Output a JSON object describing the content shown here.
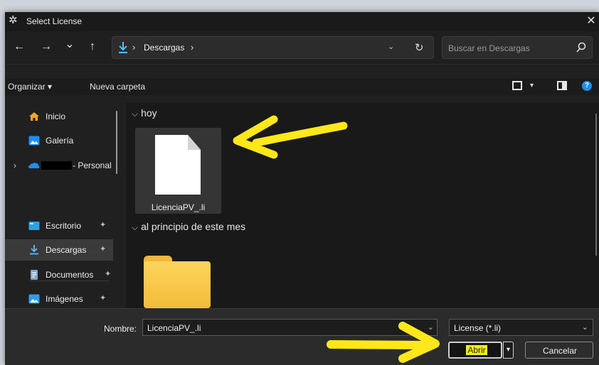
{
  "window": {
    "title": "Select License",
    "close_glyph": "✕"
  },
  "nav": {
    "back": "←",
    "forward": "→",
    "recent": "⌄",
    "up": "↑",
    "breadcrumb_sep": "›",
    "path": [
      "Descargas"
    ],
    "refresh": "↻",
    "dropdown": "⌄",
    "search_placeholder": "Buscar en Descargas"
  },
  "command_bar": {
    "organize": "Organizar ▾",
    "new_folder": "Nueva carpeta",
    "view_dropdown": "▾",
    "help": "?"
  },
  "sidebar": {
    "items": [
      {
        "label": "Inicio",
        "icon": "home-icon",
        "pinned": false
      },
      {
        "label": "Galería",
        "icon": "gallery-icon",
        "pinned": false
      },
      {
        "label": "- Personal",
        "icon": "onedrive-icon",
        "pinned": false,
        "expander": "›"
      },
      {
        "label": "Escritorio",
        "icon": "desktop-icon",
        "pinned": true
      },
      {
        "label": "Descargas",
        "icon": "download-icon",
        "pinned": true,
        "selected": true
      },
      {
        "label": "Documentos",
        "icon": "documents-icon",
        "pinned": true
      },
      {
        "label": "Imágenes",
        "icon": "pictures-icon",
        "pinned": true
      }
    ],
    "pin_glyph": "✦"
  },
  "content": {
    "groups": [
      {
        "label": "hoy",
        "chevron": "⌵"
      },
      {
        "label": "al principio de este mes",
        "chevron": "⌵"
      }
    ],
    "files": [
      {
        "name": "LicenciaPV_.li",
        "type": "file",
        "selected": true
      }
    ]
  },
  "footer": {
    "name_label": "Nombre:",
    "name_value": "LicenciaPV_.li",
    "name_dropdown": "⌄",
    "filter_value": "License (*.li)",
    "filter_dropdown": "⌄",
    "open_label": "Abrir",
    "open_dropdown": "▾",
    "cancel_label": "Cancelar"
  },
  "colors": {
    "background": "#202020",
    "accent": "#1f8ef1",
    "highlight": "#f2ee1a",
    "folder": "#f6c64a"
  }
}
